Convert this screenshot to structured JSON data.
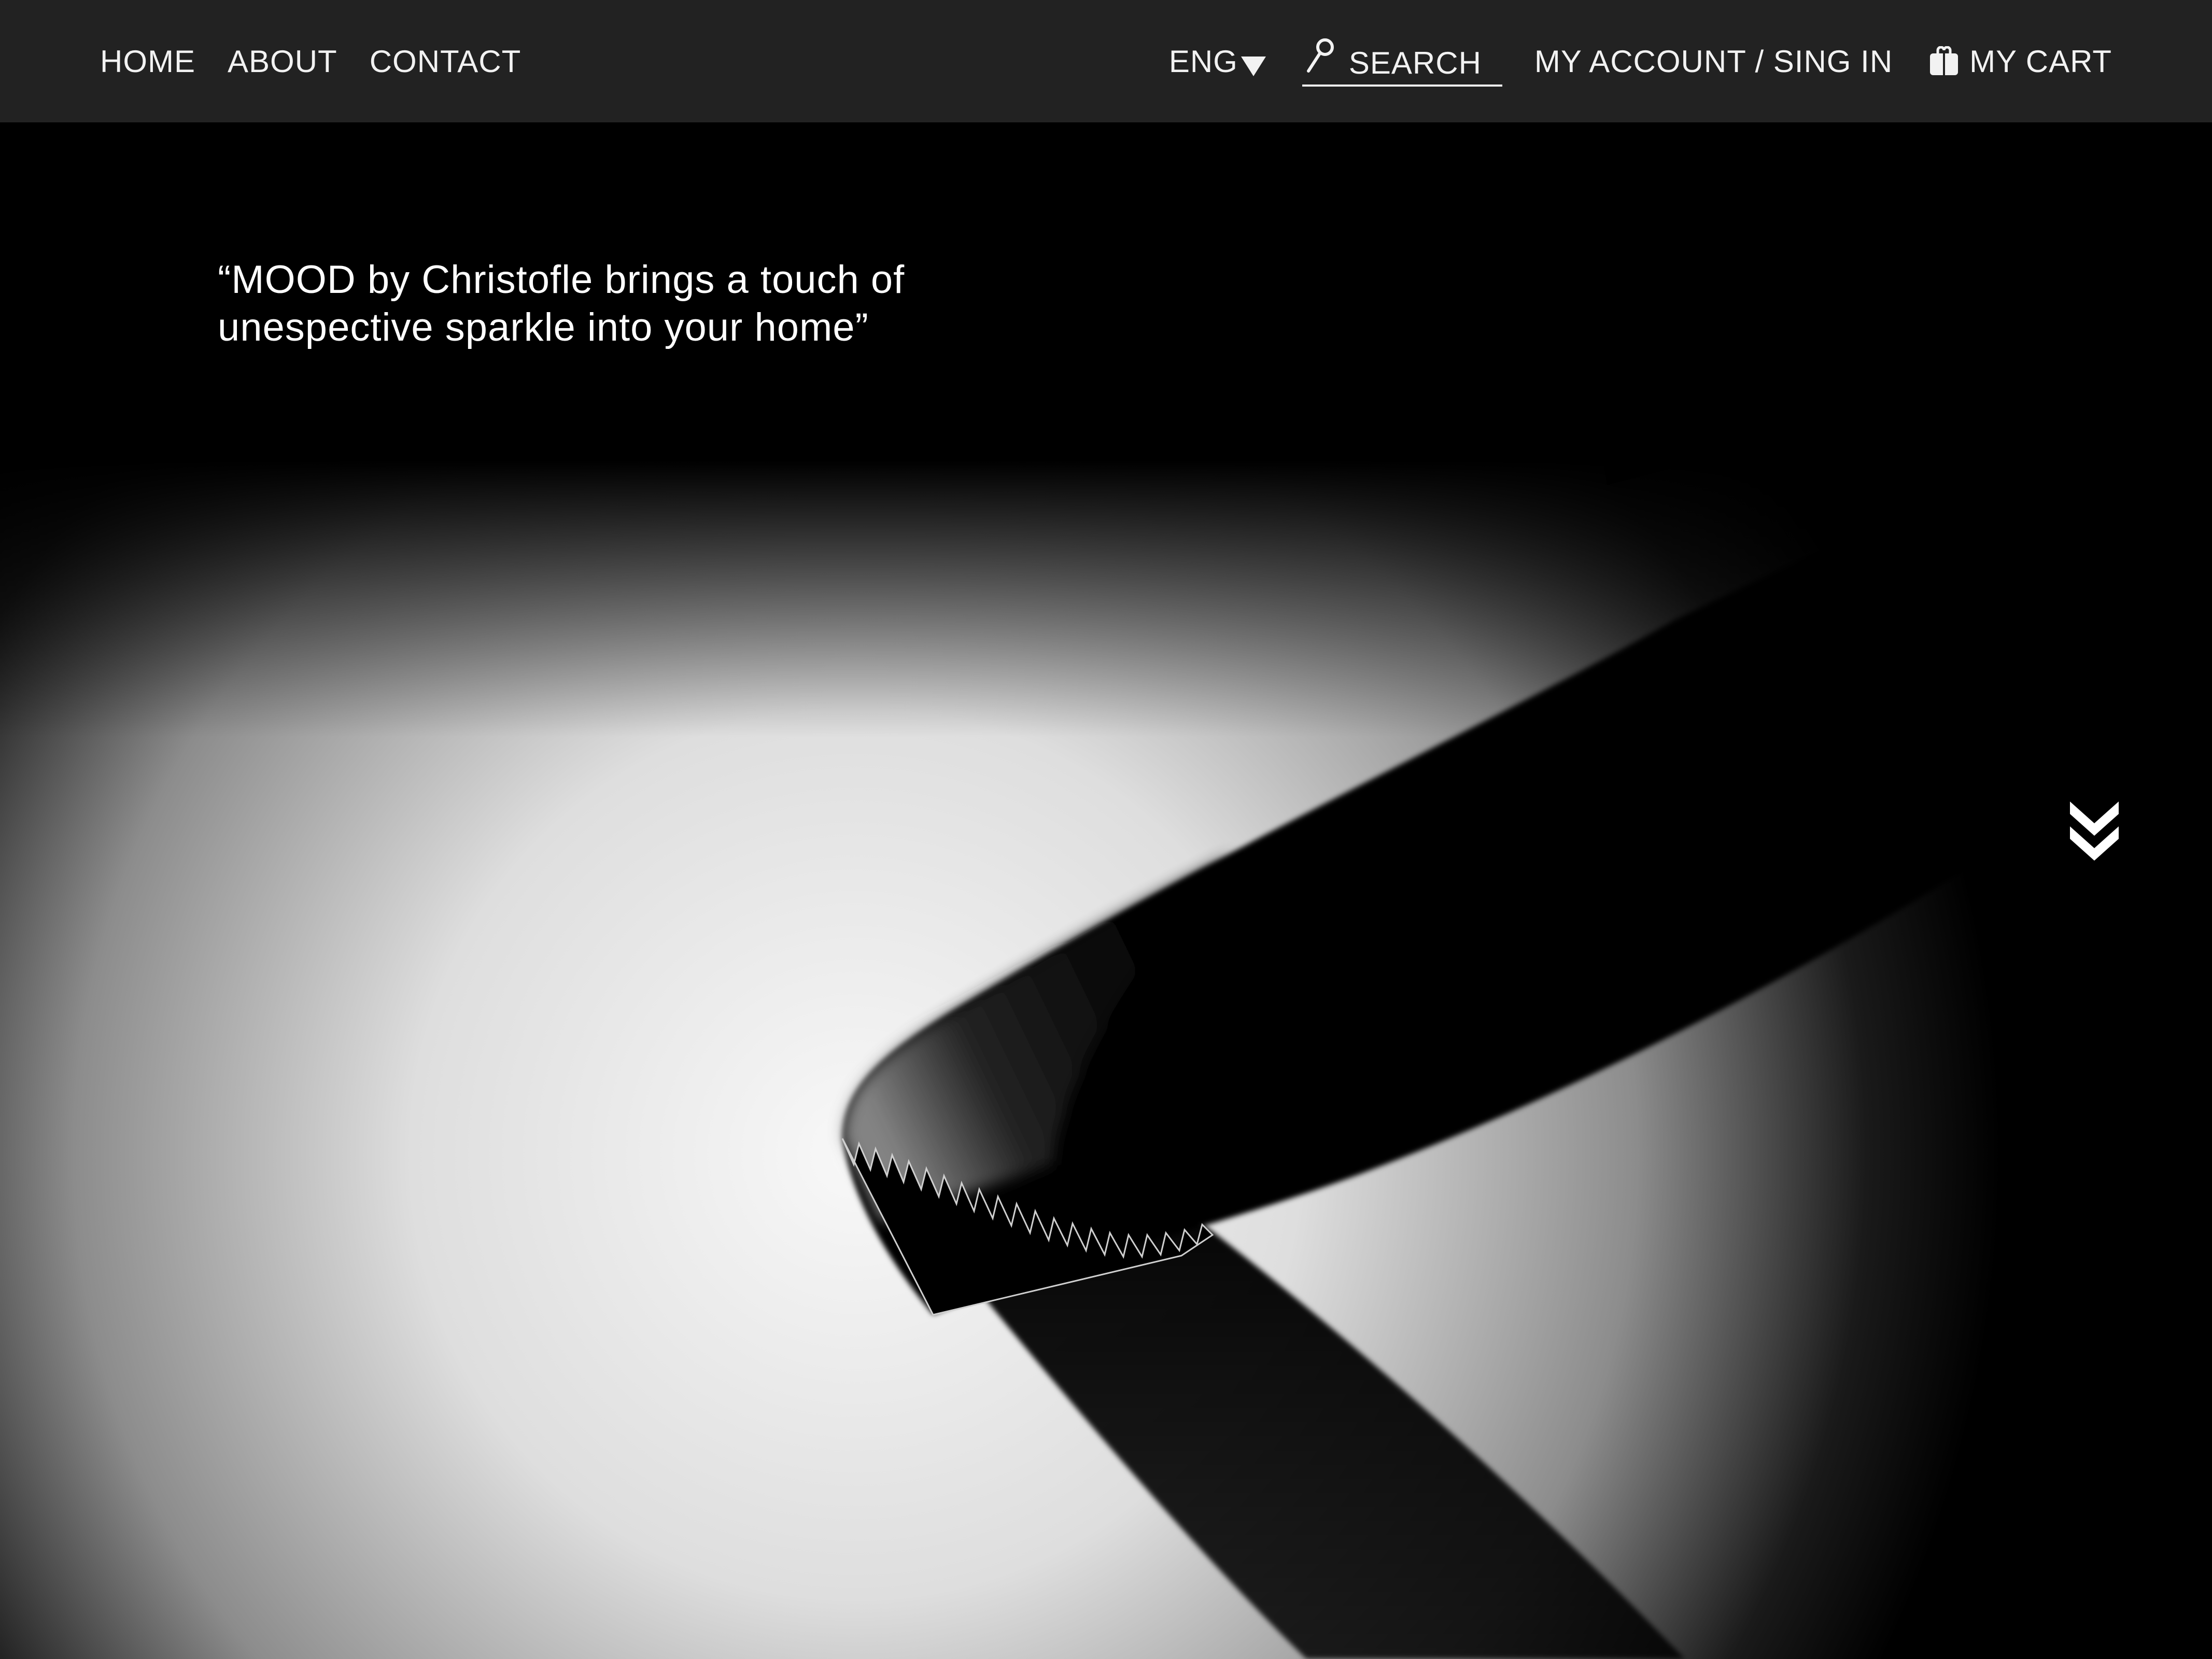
{
  "nav": {
    "left_links": [
      "HOME",
      "ABOUT",
      "CONTACT"
    ],
    "language": "ENG",
    "search_label": "SEARCH",
    "account_label": "MY ACCOUNT / SING IN",
    "cart_label": "MY CART"
  },
  "hero": {
    "quote_line1": "“MOOD by Christofle brings a touch of",
    "quote_line2": "unespective sparkle into your home”"
  },
  "icons": {
    "language": "dropdown-triangle-icon",
    "search": "magnifier-icon",
    "cart": "shopping-bag-icon",
    "scroll": "double-chevron-down-icon"
  },
  "colors": {
    "topbar_bg": "#222222",
    "hero_bg": "#000000",
    "text": "#f2f2f2"
  }
}
